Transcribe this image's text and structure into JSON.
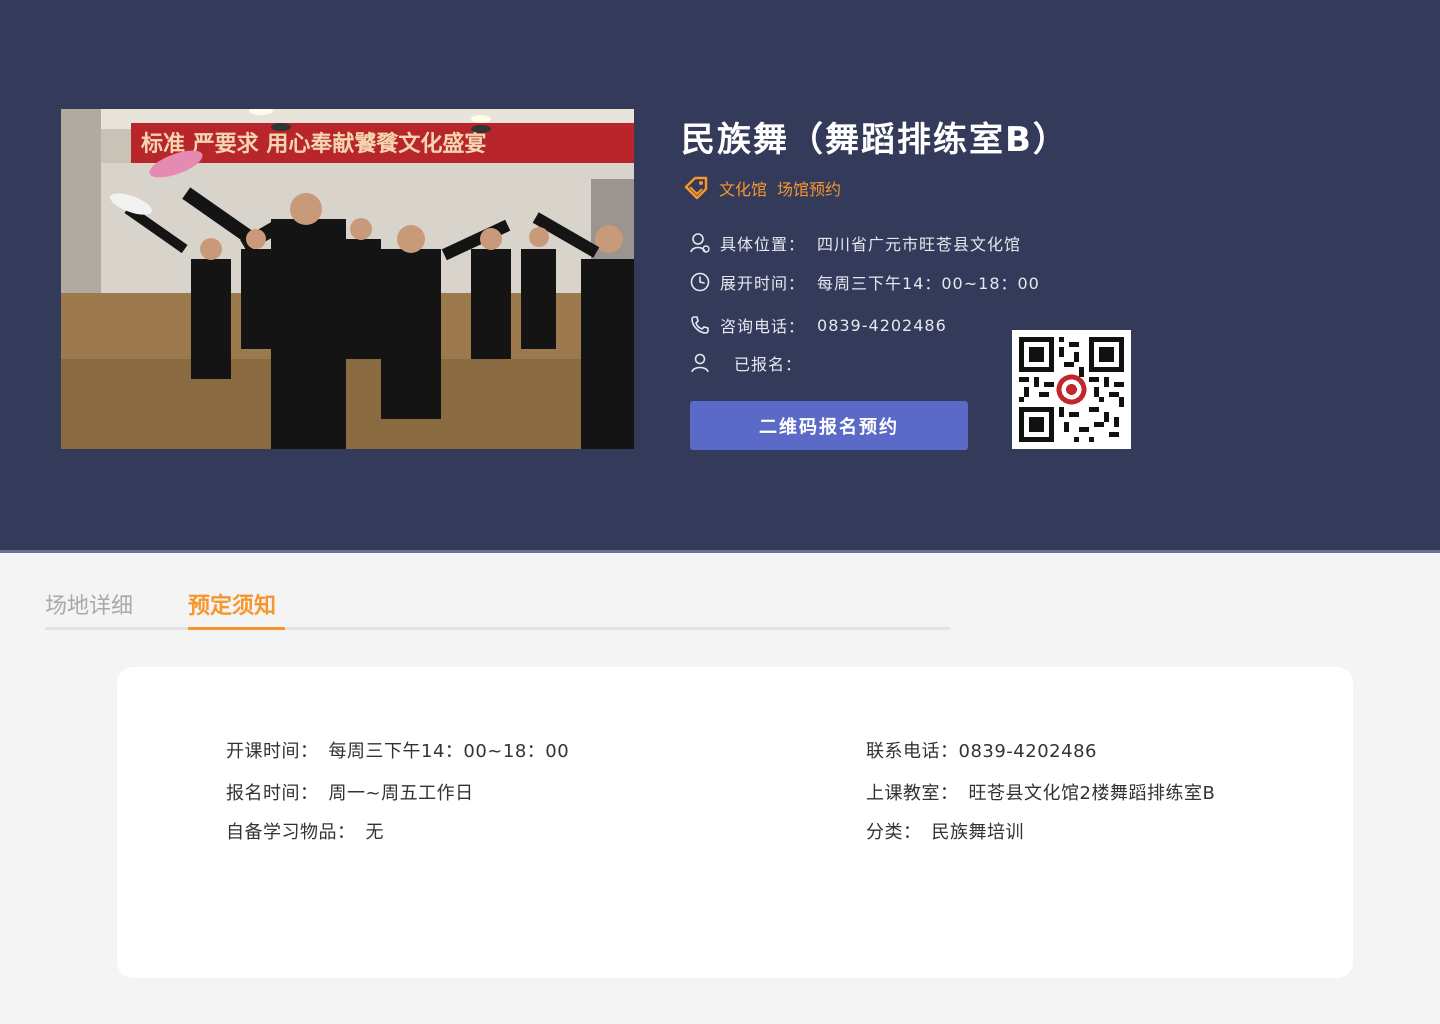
{
  "venue": {
    "title": "民族舞（舞蹈排练室B）",
    "tags": [
      "文化馆",
      "场馆预约"
    ],
    "location_label": "具体位置：",
    "location_value": "四川省广元市旺苍县文化馆",
    "time_label": "展开时间：",
    "time_value": "每周三下午14：00~18：00",
    "phone_label": "咨询电话：",
    "phone_value": "0839-4202486",
    "signed_label": "已报名：",
    "signed_value": "",
    "qr_button_label": "二维码报名预约",
    "photo_banner_text": "标准 严要求 用心奉献饕餮文化盛宴"
  },
  "tabs": [
    {
      "label": "场地详细",
      "active": false
    },
    {
      "label": "预定须知",
      "active": true
    }
  ],
  "notice": {
    "class_time_label": "开课时间：",
    "class_time_value": "每周三下午14：00~18：00",
    "signup_time_label": "报名时间：",
    "signup_time_value": "周一~周五工作日",
    "materials_label": "自备学习物品：",
    "materials_value": "无",
    "contact_label": "联系电话：",
    "contact_value": "0839-4202486",
    "classroom_label": "上课教室：",
    "classroom_value": "旺苍县文化馆2楼舞蹈排练室B",
    "category_label": "分类：",
    "category_value": "民族舞培训"
  },
  "colors": {
    "hero_bg": "#333a5a",
    "accent_orange": "#f6962d",
    "button_blue": "#5a6ac6",
    "page_bg": "#f4f4f4"
  },
  "icons": {
    "tag": "tag-icon",
    "location": "location-pin-icon",
    "time": "clock-icon",
    "phone": "phone-icon",
    "signed": "user-icon"
  }
}
